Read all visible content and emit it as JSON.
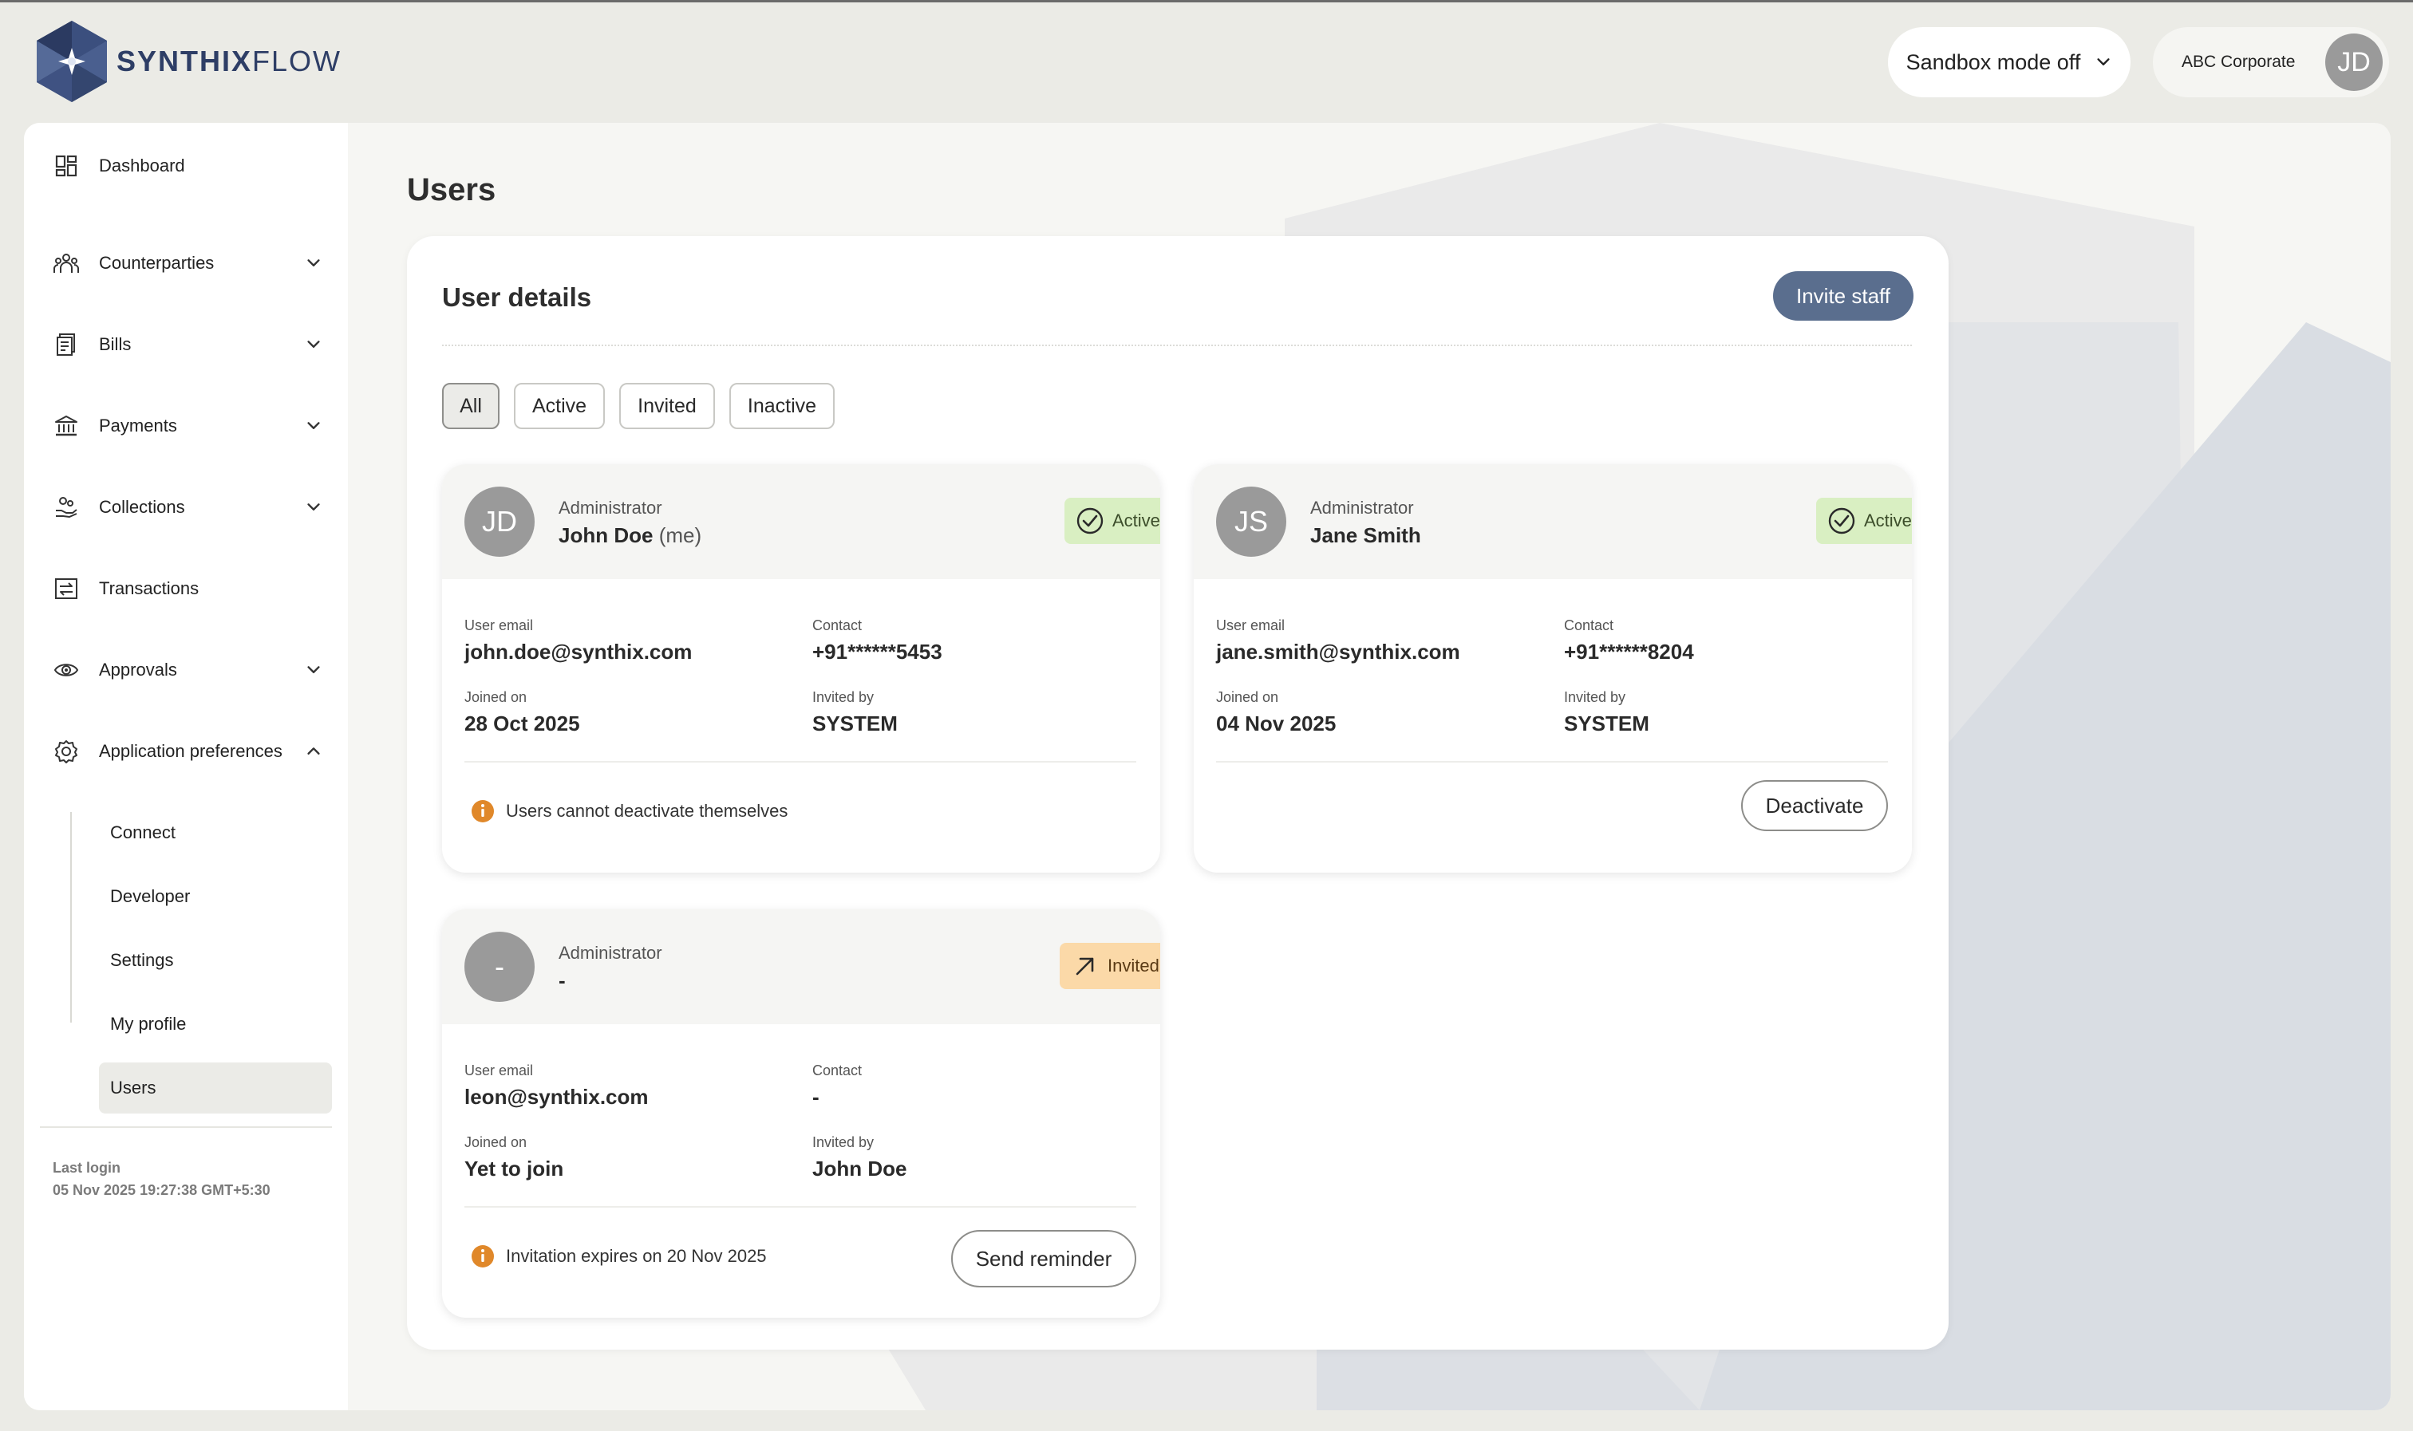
{
  "brand": {
    "logo_bold": "SYNTHIX",
    "logo_light": "FLOW",
    "colors": {
      "primary": "#2e3e66",
      "accent": "#5a6e8e",
      "active_badge": "#d9efc2",
      "invited_badge": "#fbd9a8"
    }
  },
  "header": {
    "sandbox_label": "Sandbox mode off",
    "account_name": "ABC Corporate",
    "account_initials": "JD"
  },
  "sidebar": {
    "items": [
      {
        "label": "Dashboard",
        "icon": "dashboard-icon"
      },
      {
        "label": "Counterparties",
        "icon": "people-icon"
      },
      {
        "label": "Bills",
        "icon": "bills-icon"
      },
      {
        "label": "Payments",
        "icon": "bank-icon"
      },
      {
        "label": "Collections",
        "icon": "collections-icon"
      },
      {
        "label": "Transactions",
        "icon": "transactions-icon"
      },
      {
        "label": "Approvals",
        "icon": "eye-icon"
      },
      {
        "label": "Application preferences",
        "icon": "gear-icon"
      }
    ],
    "subitems": [
      "Connect",
      "Developer",
      "Settings",
      "My profile",
      "Users"
    ],
    "active_subitem": "Users",
    "last_login_label": "Last login",
    "last_login_value": "05 Nov 2025 19:27:38 GMT+5:30"
  },
  "main": {
    "page_title": "Users",
    "panel_title": "User details",
    "invite_label": "Invite staff",
    "filters": [
      "All",
      "Active",
      "Invited",
      "Inactive"
    ],
    "active_filter": "All",
    "field_labels": {
      "email": "User email",
      "contact": "Contact",
      "joined": "Joined on",
      "invited_by": "Invited by"
    },
    "users": [
      {
        "initials": "JD",
        "role": "Administrator",
        "name": "John Doe",
        "name_suffix": "(me)",
        "status": "Active",
        "email": "john.doe@synthix.com",
        "contact": "+91******5453",
        "joined": "28 Oct 2025",
        "invited_by": "SYSTEM",
        "note": "Users cannot deactivate themselves"
      },
      {
        "initials": "JS",
        "role": "Administrator",
        "name": "Jane Smith",
        "status": "Active",
        "email": "jane.smith@synthix.com",
        "contact": "+91******8204",
        "joined": "04 Nov 2025",
        "invited_by": "SYSTEM",
        "action": "Deactivate"
      },
      {
        "initials": "-",
        "role": "Administrator",
        "name": "-",
        "status": "Invited",
        "email": "leon@synthix.com",
        "contact": "-",
        "joined": "Yet to join",
        "invited_by": "John Doe",
        "note": "Invitation expires on 20 Nov 2025",
        "action": "Send reminder"
      }
    ]
  }
}
